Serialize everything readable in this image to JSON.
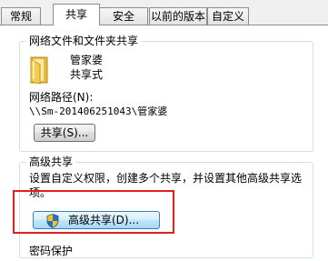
{
  "tabs": [
    {
      "label": "常规",
      "active": false
    },
    {
      "label": "共享",
      "active": true
    },
    {
      "label": "安全",
      "active": false
    },
    {
      "label": "以前的版本",
      "active": false
    },
    {
      "label": "自定义",
      "active": false
    }
  ],
  "network_sharing": {
    "title": "网络文件和文件夹共享",
    "folder_name": "管家婆",
    "folder_status": "共享式",
    "path_label": "网络路径(N):",
    "path_value": "\\\\Sm-201406251043\\管家婆",
    "share_button": "共享(S)..."
  },
  "advanced_sharing": {
    "title": "高级共享",
    "description_line1": "设置自定义权限，创建多个共享，并设置其他高级共享选",
    "description_line2": "项。",
    "button_label": "高级共享(D)..."
  },
  "password_protection": {
    "title": "密码保护"
  },
  "colors": {
    "highlight_box": "#e02020",
    "group_border": "#d5dfe5",
    "folder_yellow": "#f3cd52",
    "shield_blue": "#2e6fcb",
    "shield_yellow": "#f5c518"
  },
  "icons": [
    "folder-icon",
    "uac-shield-icon"
  ]
}
